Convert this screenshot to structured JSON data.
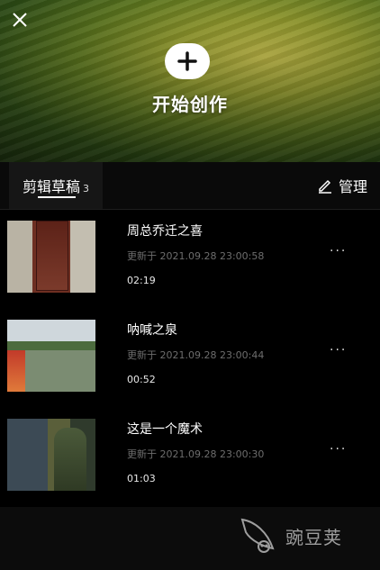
{
  "header": {
    "create_label": "开始创作"
  },
  "tabs": {
    "drafts_label": "剪辑草稿",
    "drafts_count": "3",
    "manage_label": "管理"
  },
  "drafts": [
    {
      "title": "周总乔迁之喜",
      "updated": "更新于 2021.09.28 23:00:58",
      "duration": "02:19",
      "more": "···"
    },
    {
      "title": "呐喊之泉",
      "updated": "更新于 2021.09.28 23:00:44",
      "duration": "00:52",
      "more": "···"
    },
    {
      "title": "这是一个魔术",
      "updated": "更新于 2021.09.28 23:00:30",
      "duration": "01:03",
      "more": "···"
    }
  ],
  "watermark": {
    "text": "豌豆荚"
  },
  "icons": {
    "close": "close-icon",
    "plus": "plus-icon",
    "edit": "pencil-icon",
    "more": "more-icon",
    "watermark_logo": "wandoujia-logo"
  },
  "colors": {
    "background": "#0a0a0a",
    "secondary_text": "#6d6d6d",
    "tab_bg": "#161616"
  }
}
